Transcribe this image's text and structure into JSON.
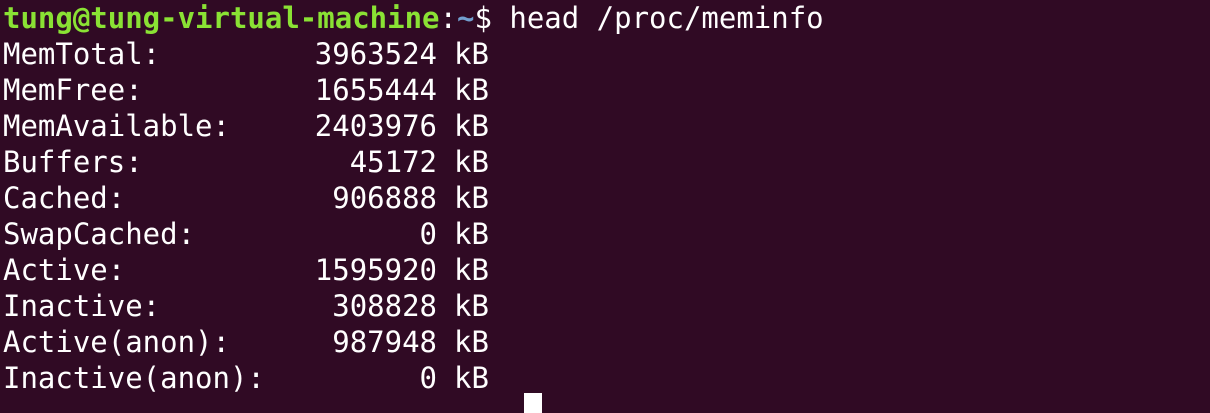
{
  "prompt": {
    "user_host": "tung@tung-virtual-machine",
    "colon": ":",
    "path": "~",
    "symbol": "$",
    "command": "head /proc/meminfo"
  },
  "meminfo": [
    {
      "name": "MemTotal:",
      "value": "3963524",
      "unit": "kB"
    },
    {
      "name": "MemFree:",
      "value": "1655444",
      "unit": "kB"
    },
    {
      "name": "MemAvailable:",
      "value": "2403976",
      "unit": "kB"
    },
    {
      "name": "Buffers:",
      "value": "45172",
      "unit": "kB"
    },
    {
      "name": "Cached:",
      "value": "906888",
      "unit": "kB"
    },
    {
      "name": "SwapCached:",
      "value": "0",
      "unit": "kB"
    },
    {
      "name": "Active:",
      "value": "1595920",
      "unit": "kB"
    },
    {
      "name": "Inactive:",
      "value": "308828",
      "unit": "kB"
    },
    {
      "name": "Active(anon):",
      "value": "987948",
      "unit": "kB"
    },
    {
      "name": "Inactive(anon):",
      "value": "0",
      "unit": "kB"
    }
  ],
  "colors": {
    "background": "#300a24",
    "user_host": "#8ae234",
    "path": "#729fcf",
    "text": "#ffffff"
  }
}
